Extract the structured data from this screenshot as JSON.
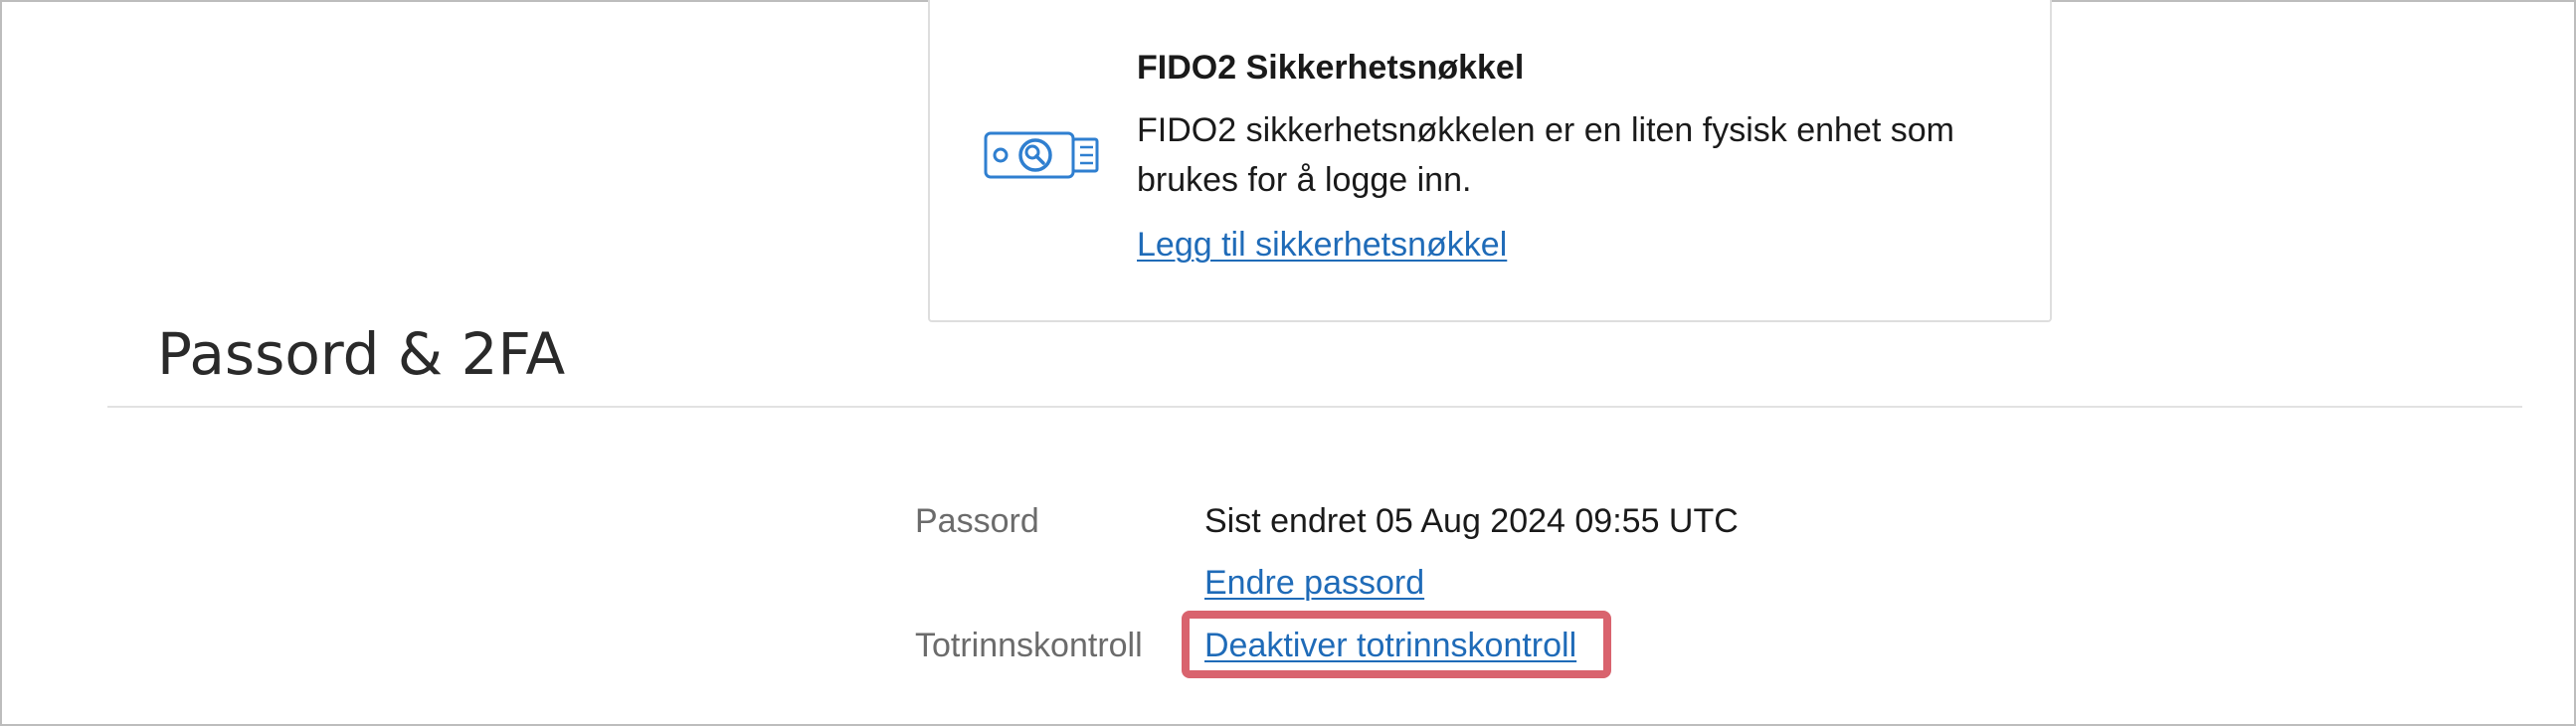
{
  "fido_card": {
    "title": "FIDO2 Sikkerhetsnøkkel",
    "description": "FIDO2 sikkerhetsnøkkelen er en liten fysisk enhet som brukes for å logge inn.",
    "add_link": "Legg til sikkerhetsnøkkel",
    "icon": "usb-security-key-icon"
  },
  "section": {
    "title": "Passord & 2FA"
  },
  "password": {
    "label": "Passord",
    "status": "Sist endret 05 Aug 2024 09:55 UTC",
    "change_link": "Endre passord"
  },
  "two_factor": {
    "label": "Totrinnskontroll",
    "deactivate_link": "Deaktiver totrinnskontroll"
  },
  "colors": {
    "link": "#1f6bb8",
    "icon": "#2f7fd0",
    "highlight": "#d9636e"
  }
}
